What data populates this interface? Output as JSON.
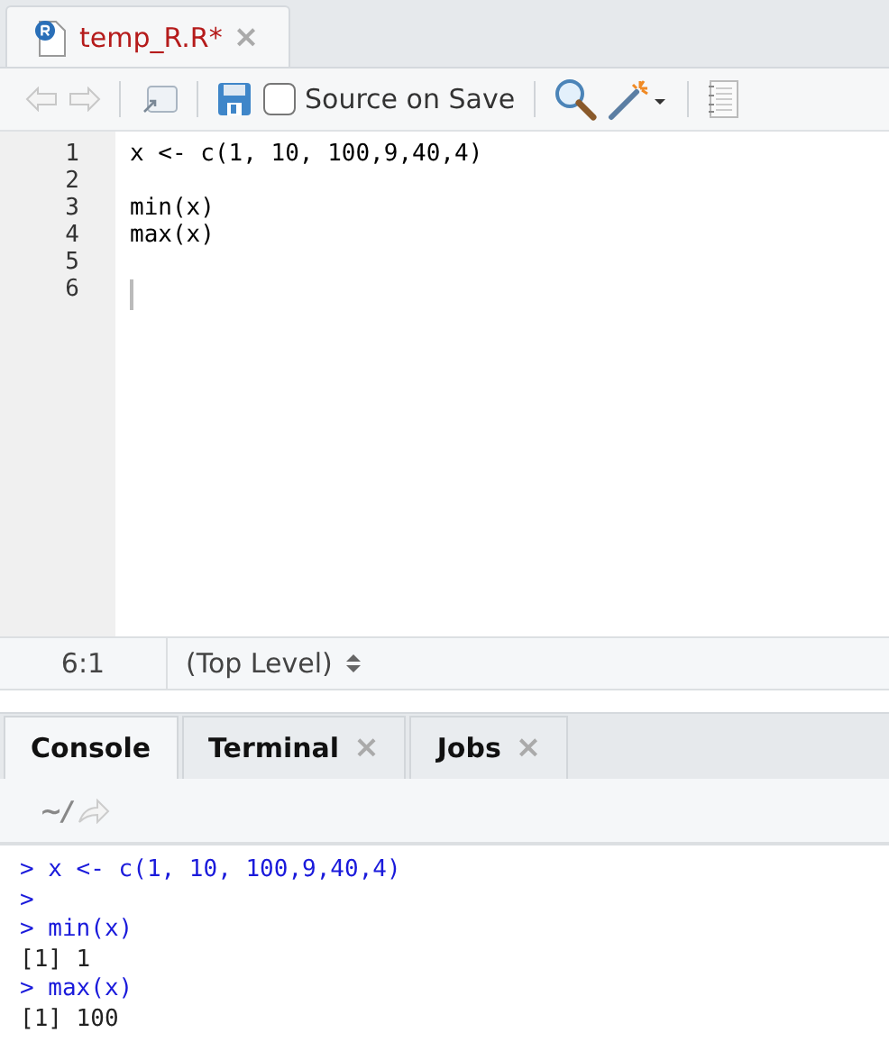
{
  "editor_tab": {
    "title": "temp_R.R*",
    "modified": true,
    "close": "×"
  },
  "toolbar": {
    "source_on_save": {
      "label": "Source on Save",
      "checked": false
    }
  },
  "code_lines": [
    {
      "number": "1",
      "text": "x <- c(1, 10, 100,9,40,4)"
    },
    {
      "number": "2"
    },
    {
      "number": "3",
      "text": "min(x)"
    },
    {
      "number": "4",
      "text": "max(x)"
    },
    {
      "number": "5"
    },
    {
      "number": "6",
      "cursor": true
    }
  ],
  "status_bar": {
    "position": "6:1",
    "scope": "(Top Level)"
  },
  "console_tabs": [
    {
      "label": "Console",
      "selected": true
    },
    {
      "label": "Terminal",
      "selected": false,
      "close": "×"
    },
    {
      "label": "Jobs",
      "selected": false,
      "close": "×"
    }
  ],
  "console_path": "~/",
  "console_lines": [
    {
      "kind": "input",
      "text": "> x <- c(1, 10, 100,9,40,4)"
    },
    {
      "kind": "input",
      "text": ">"
    },
    {
      "kind": "input",
      "text": "> min(x)"
    },
    {
      "kind": "output",
      "text": "[1] 1"
    },
    {
      "kind": "input",
      "text": "> max(x)"
    },
    {
      "kind": "output",
      "text": "[1] 100"
    }
  ]
}
